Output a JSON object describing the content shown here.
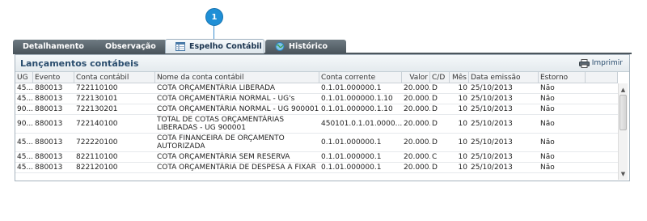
{
  "callout": {
    "number": "1"
  },
  "tabs": [
    {
      "label": "Detalhamento",
      "active": false
    },
    {
      "label": "Observação",
      "active": false
    },
    {
      "label": "Espelho Contábil",
      "active": true,
      "icon": "ledger-icon"
    },
    {
      "label": "Histórico",
      "active": false,
      "icon": "globe-icon"
    }
  ],
  "panel": {
    "title": "Lançamentos contábeis",
    "print_label": "Imprimir",
    "print_icon": "printer-icon"
  },
  "table": {
    "columns": [
      "UG",
      "Evento",
      "Conta contábil",
      "Nome da conta contábil",
      "Conta corrente",
      "Valor",
      "C/D",
      "Mês",
      "Data emissão",
      "Estorno"
    ],
    "rows": [
      [
        "45...",
        "880013",
        "722110100",
        "COTA ORÇAMENTÁRIA LIBERADA",
        "0.1.01.000000.1",
        "20.000...",
        "D",
        "10",
        "25/10/2013",
        "Não"
      ],
      [
        "45...",
        "880013",
        "722130101",
        "COTA ORÇAMENTÁRIA NORMAL - UG's",
        "0.1.01.000000.1.10",
        "20.000...",
        "D",
        "10",
        "25/10/2013",
        "Não"
      ],
      [
        "90...",
        "880013",
        "722130201",
        "COTA ORÇAMENTÁRIA NORMAL - UG 900001",
        "0.1.01.000000.1.10",
        "20.000...",
        "D",
        "10",
        "25/10/2013",
        "Não"
      ],
      [
        "90...",
        "880013",
        "722140100",
        "TOTAL DE COTAS ORÇAMENTÁRIAS LIBERADAS - UG 900001",
        "450101.0.1.01.0000...",
        "20.000...",
        "D",
        "10",
        "25/10/2013",
        "Não"
      ],
      [
        "45...",
        "880013",
        "722220100",
        "COTA FINANCEIRA DE ORÇAMENTO AUTORIZADA",
        "0.1.01.000000.1",
        "20.000...",
        "D",
        "10",
        "25/10/2013",
        "Não"
      ],
      [
        "45...",
        "880013",
        "822110100",
        "COTA ORÇAMENTÁRIA SEM RESERVA",
        "0.1.01.000000.1",
        "20.000...",
        "C",
        "10",
        "25/10/2013",
        "Não"
      ],
      [
        "45...",
        "880013",
        "822120100",
        "COTA ORÇAMENTÁRIA DE DESPESA A FIXAR",
        "0.1.01.000000.1",
        "20.000...",
        "D",
        "10",
        "25/10/2013",
        "Não"
      ]
    ]
  },
  "colors": {
    "callout": "#1f8fd6",
    "tab_dark": "#4b555c",
    "title": "#2a4d6e"
  }
}
